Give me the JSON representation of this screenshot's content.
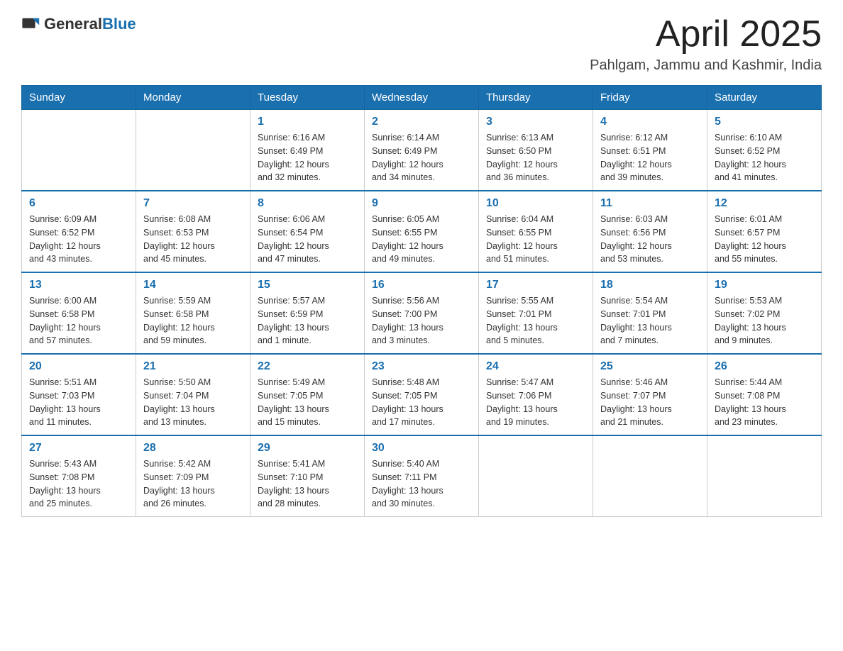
{
  "header": {
    "logo_general": "General",
    "logo_blue": "Blue",
    "month": "April 2025",
    "location": "Pahlgam, Jammu and Kashmir, India"
  },
  "days_of_week": [
    "Sunday",
    "Monday",
    "Tuesday",
    "Wednesday",
    "Thursday",
    "Friday",
    "Saturday"
  ],
  "weeks": [
    [
      {
        "day": "",
        "info": ""
      },
      {
        "day": "",
        "info": ""
      },
      {
        "day": "1",
        "info": "Sunrise: 6:16 AM\nSunset: 6:49 PM\nDaylight: 12 hours\nand 32 minutes."
      },
      {
        "day": "2",
        "info": "Sunrise: 6:14 AM\nSunset: 6:49 PM\nDaylight: 12 hours\nand 34 minutes."
      },
      {
        "day": "3",
        "info": "Sunrise: 6:13 AM\nSunset: 6:50 PM\nDaylight: 12 hours\nand 36 minutes."
      },
      {
        "day": "4",
        "info": "Sunrise: 6:12 AM\nSunset: 6:51 PM\nDaylight: 12 hours\nand 39 minutes."
      },
      {
        "day": "5",
        "info": "Sunrise: 6:10 AM\nSunset: 6:52 PM\nDaylight: 12 hours\nand 41 minutes."
      }
    ],
    [
      {
        "day": "6",
        "info": "Sunrise: 6:09 AM\nSunset: 6:52 PM\nDaylight: 12 hours\nand 43 minutes."
      },
      {
        "day": "7",
        "info": "Sunrise: 6:08 AM\nSunset: 6:53 PM\nDaylight: 12 hours\nand 45 minutes."
      },
      {
        "day": "8",
        "info": "Sunrise: 6:06 AM\nSunset: 6:54 PM\nDaylight: 12 hours\nand 47 minutes."
      },
      {
        "day": "9",
        "info": "Sunrise: 6:05 AM\nSunset: 6:55 PM\nDaylight: 12 hours\nand 49 minutes."
      },
      {
        "day": "10",
        "info": "Sunrise: 6:04 AM\nSunset: 6:55 PM\nDaylight: 12 hours\nand 51 minutes."
      },
      {
        "day": "11",
        "info": "Sunrise: 6:03 AM\nSunset: 6:56 PM\nDaylight: 12 hours\nand 53 minutes."
      },
      {
        "day": "12",
        "info": "Sunrise: 6:01 AM\nSunset: 6:57 PM\nDaylight: 12 hours\nand 55 minutes."
      }
    ],
    [
      {
        "day": "13",
        "info": "Sunrise: 6:00 AM\nSunset: 6:58 PM\nDaylight: 12 hours\nand 57 minutes."
      },
      {
        "day": "14",
        "info": "Sunrise: 5:59 AM\nSunset: 6:58 PM\nDaylight: 12 hours\nand 59 minutes."
      },
      {
        "day": "15",
        "info": "Sunrise: 5:57 AM\nSunset: 6:59 PM\nDaylight: 13 hours\nand 1 minute."
      },
      {
        "day": "16",
        "info": "Sunrise: 5:56 AM\nSunset: 7:00 PM\nDaylight: 13 hours\nand 3 minutes."
      },
      {
        "day": "17",
        "info": "Sunrise: 5:55 AM\nSunset: 7:01 PM\nDaylight: 13 hours\nand 5 minutes."
      },
      {
        "day": "18",
        "info": "Sunrise: 5:54 AM\nSunset: 7:01 PM\nDaylight: 13 hours\nand 7 minutes."
      },
      {
        "day": "19",
        "info": "Sunrise: 5:53 AM\nSunset: 7:02 PM\nDaylight: 13 hours\nand 9 minutes."
      }
    ],
    [
      {
        "day": "20",
        "info": "Sunrise: 5:51 AM\nSunset: 7:03 PM\nDaylight: 13 hours\nand 11 minutes."
      },
      {
        "day": "21",
        "info": "Sunrise: 5:50 AM\nSunset: 7:04 PM\nDaylight: 13 hours\nand 13 minutes."
      },
      {
        "day": "22",
        "info": "Sunrise: 5:49 AM\nSunset: 7:05 PM\nDaylight: 13 hours\nand 15 minutes."
      },
      {
        "day": "23",
        "info": "Sunrise: 5:48 AM\nSunset: 7:05 PM\nDaylight: 13 hours\nand 17 minutes."
      },
      {
        "day": "24",
        "info": "Sunrise: 5:47 AM\nSunset: 7:06 PM\nDaylight: 13 hours\nand 19 minutes."
      },
      {
        "day": "25",
        "info": "Sunrise: 5:46 AM\nSunset: 7:07 PM\nDaylight: 13 hours\nand 21 minutes."
      },
      {
        "day": "26",
        "info": "Sunrise: 5:44 AM\nSunset: 7:08 PM\nDaylight: 13 hours\nand 23 minutes."
      }
    ],
    [
      {
        "day": "27",
        "info": "Sunrise: 5:43 AM\nSunset: 7:08 PM\nDaylight: 13 hours\nand 25 minutes."
      },
      {
        "day": "28",
        "info": "Sunrise: 5:42 AM\nSunset: 7:09 PM\nDaylight: 13 hours\nand 26 minutes."
      },
      {
        "day": "29",
        "info": "Sunrise: 5:41 AM\nSunset: 7:10 PM\nDaylight: 13 hours\nand 28 minutes."
      },
      {
        "day": "30",
        "info": "Sunrise: 5:40 AM\nSunset: 7:11 PM\nDaylight: 13 hours\nand 30 minutes."
      },
      {
        "day": "",
        "info": ""
      },
      {
        "day": "",
        "info": ""
      },
      {
        "day": "",
        "info": ""
      }
    ]
  ]
}
